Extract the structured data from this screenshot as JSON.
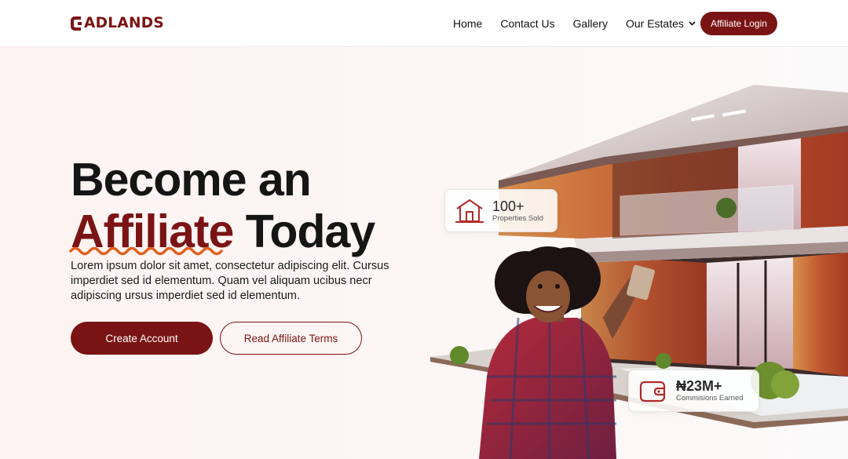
{
  "header": {
    "logo_text": "ADLANDS",
    "nav": [
      {
        "label": "Home"
      },
      {
        "label": "Contact Us"
      },
      {
        "label": "Gallery"
      },
      {
        "label": "Our Estates"
      }
    ],
    "login_label": "Affiliate Login"
  },
  "hero": {
    "headline_line1": "Become an",
    "headline_highlight": "Affiliate",
    "headline_rest": "Today",
    "description": "Lorem ipsum dolor sit amet, consectetur adipiscing elit. Cursus imperdiet sed id elementum. Quam vel aliquam ucibus necr adipiscing ursus imperdiet sed id elementum.",
    "primary_cta": "Create Account",
    "secondary_cta": "Read Affiliate Terms"
  },
  "stats": [
    {
      "value": "100+",
      "label": "Properties Sold",
      "icon": "house-icon"
    },
    {
      "value": "₦23M+",
      "label": "Commisions Earned",
      "icon": "wallet-icon"
    }
  ],
  "colors": {
    "brand": "#7a1414",
    "accent_squiggle": "#e0601e",
    "background": "#fdf3f2"
  }
}
